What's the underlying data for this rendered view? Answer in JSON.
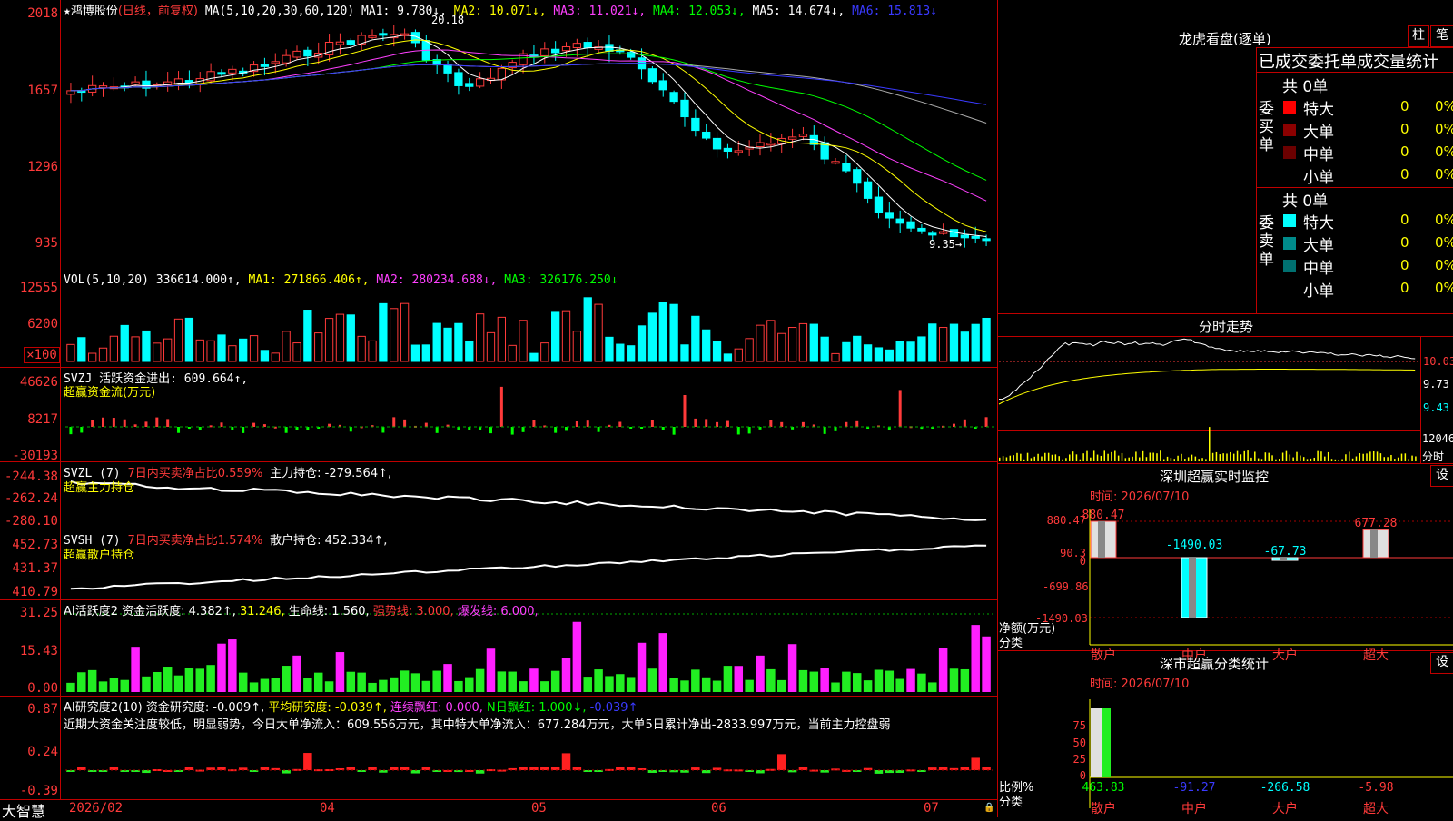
{
  "main_chart": {
    "star": "★",
    "stock_name": "鸿博股份",
    "period_label": "(日线，前复权)",
    "ma_label": "MA(5,10,20,30,60,120)",
    "ma1": "MA1: 9.780↓,",
    "ma2": "MA2: 10.071↓,",
    "ma3": "MA3: 11.021↓,",
    "ma4": "MA4: 12.053↓,",
    "ma5": "MA5: 14.674↓,",
    "ma6": "MA6: 15.813↓",
    "axis": [
      "2018",
      "1657",
      "1296",
      "935"
    ],
    "high_marker": "20.18",
    "low_marker": "9.35→"
  },
  "vol_panel": {
    "label": "VOL(5,10,20)",
    "value": "336614.000↑,",
    "ma1": "MA1: 271866.406↑,",
    "ma2": "MA2: 280234.688↓,",
    "ma3": "MA3: 326176.250↓",
    "axis": [
      "12555",
      "6200",
      "×100"
    ]
  },
  "svzj_panel": {
    "label": "SVZJ  活跃资金进出: 609.664↑,",
    "sublabel": "超赢资金流(万元)",
    "axis": [
      "46626",
      "8217",
      "-30193"
    ]
  },
  "svzl_panel": {
    "label": "SVZL (7)",
    "ratio": "7日内买卖净占比0.559%",
    "hold": "主力持仓: -279.564↑,",
    "sublabel": "超赢主力持仓",
    "axis": [
      "-244.38",
      "-262.24",
      "-280.10"
    ]
  },
  "svsh_panel": {
    "label": "SVSH (7)",
    "ratio": "7日内买卖净占比1.574%",
    "hold": "散户持仓: 452.334↑,",
    "sublabel": "超赢散户持仓",
    "axis": [
      "452.73",
      "431.37",
      "410.79"
    ]
  },
  "ai_active_panel": {
    "label": "AI活跃度2 资金活跃度: 4.382↑,",
    "v2": "31.246,",
    "v3": "生命线: 1.560,",
    "v4": "强势线: 3.000,",
    "v5": "爆发线: 6.000,",
    "axis": [
      "31.25",
      "15.43",
      "0.00"
    ]
  },
  "ai_research_panel": {
    "label": "AI研究度2(10)",
    "v1": "资金研究度: -0.009↑,",
    "v2": "平均研究度: -0.039↑,",
    "v3": "连续飘红: 0.000,",
    "v4": "N日飘红: 1.000↓,",
    "v5": "-0.039↑",
    "commentary": "近期大资金关注度较低，明显弱势，今日大单净流入：609.556万元，其中特大单净流入：677.284万元，大单5日累计净出-2833.997万元，当前主力控盘弱",
    "axis": [
      "0.87",
      "0.24",
      "-0.39"
    ]
  },
  "date_axis": {
    "logo": "大智慧",
    "labels": [
      "2026/02",
      "04",
      "05",
      "06",
      "07"
    ]
  },
  "dragon_tiger": {
    "title": "龙虎看盘(逐单)",
    "btn_bar": "柱",
    "btn_pen": "笔",
    "tabs": "已成交委托单成交量统计",
    "buy_label": "委买单",
    "sell_label": "委卖单",
    "buy_total": "共 0单",
    "sell_total": "共 0单",
    "rows": [
      {
        "name": "特大",
        "count": "0",
        "pct": "0%",
        "buy_color": "#ff0000",
        "sell_color": "#00ffff"
      },
      {
        "name": "大单",
        "count": "0",
        "pct": "0%",
        "buy_color": "#8b0000",
        "sell_color": "#008b8b"
      },
      {
        "name": "中单",
        "count": "0",
        "pct": "0%",
        "buy_color": "#6b0000",
        "sell_color": "#007070"
      },
      {
        "name": "小单",
        "count": "0",
        "pct": "0%",
        "buy_color": "",
        "sell_color": ""
      }
    ]
  },
  "intraday": {
    "title": "分时走势",
    "axis": [
      "10.03",
      "9.73",
      "9.43"
    ],
    "vol_top": "12046",
    "vol_label": "分时"
  },
  "realtime_monitor": {
    "title": "深圳超赢实时监控",
    "btn": "设",
    "date": "时间: 2026/07/10",
    "axis": [
      "880.47",
      "90.3",
      "0",
      "-699.86",
      "-1490.03"
    ],
    "unit_label": "净额(万元)",
    "cat_label": "分类",
    "chart_data": {
      "type": "bar",
      "categories": [
        "散户",
        "中户",
        "大户",
        "超大"
      ],
      "values": [
        880.47,
        -1490.03,
        -67.73,
        677.28
      ],
      "ylim": [
        -1490.03,
        880.47
      ]
    }
  },
  "classify_stats": {
    "title": "深市超赢分类统计",
    "btn": "设",
    "date": "时间: 2026/07/10",
    "axis": [
      "75",
      "50",
      "25",
      "0"
    ],
    "unit_label": "比例%",
    "cat_label": "分类",
    "chart_data": {
      "type": "bar",
      "categories": [
        "散户",
        "中户",
        "大户",
        "超大"
      ],
      "values": [
        463.83,
        -91.27,
        -266.58,
        -5.98
      ],
      "ylim": [
        0,
        100
      ]
    }
  },
  "colors": {
    "up": "#ff3a3a",
    "down": "#00ffff",
    "grid": "#c00000"
  }
}
